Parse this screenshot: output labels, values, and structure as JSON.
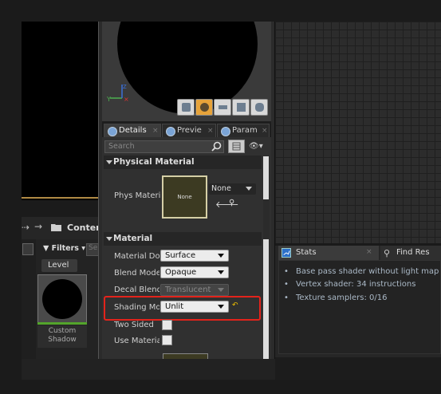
{
  "content_browser": {
    "title": "Content",
    "filters_label": "Filters",
    "search_stub": "Se",
    "level_label": "Level",
    "asset_label_line1": "Custom",
    "asset_label_line2": "Shadow"
  },
  "tabs": [
    {
      "label": "Details",
      "close": "×"
    },
    {
      "label": "Previe",
      "close": "×"
    },
    {
      "label": "Param",
      "close": "×"
    }
  ],
  "details": {
    "search_placeholder": "Search",
    "sections": {
      "physical_material": "Physical Material",
      "material": "Material"
    },
    "phys_material_label": "Phys Materia",
    "phys_thumb_text": "None",
    "phys_dropdown_value": "None",
    "properties": {
      "material_domain": {
        "label": "Material Dom",
        "value": "Surface"
      },
      "blend_mode": {
        "label": "Blend Mode",
        "value": "Opaque"
      },
      "decal_blend": {
        "label": "Decal Blend M",
        "value": "Translucent"
      },
      "shading_model": {
        "label": "Shading Mod",
        "value": "Unlit"
      },
      "two_sided": {
        "label": "Two Sided"
      },
      "use_material": {
        "label": "Use Material"
      }
    }
  },
  "stats": {
    "tab_label": "Stats",
    "tab_close": "×",
    "find_tab_label": "Find Res",
    "lines": [
      "Base pass shader without light map",
      "Vertex shader: 34 instructions",
      "Texture samplers: 0/16"
    ]
  },
  "colors": {
    "highlight": "#e3231b",
    "accent_orange": "#e7a33a",
    "asset_green": "#53a42b"
  }
}
